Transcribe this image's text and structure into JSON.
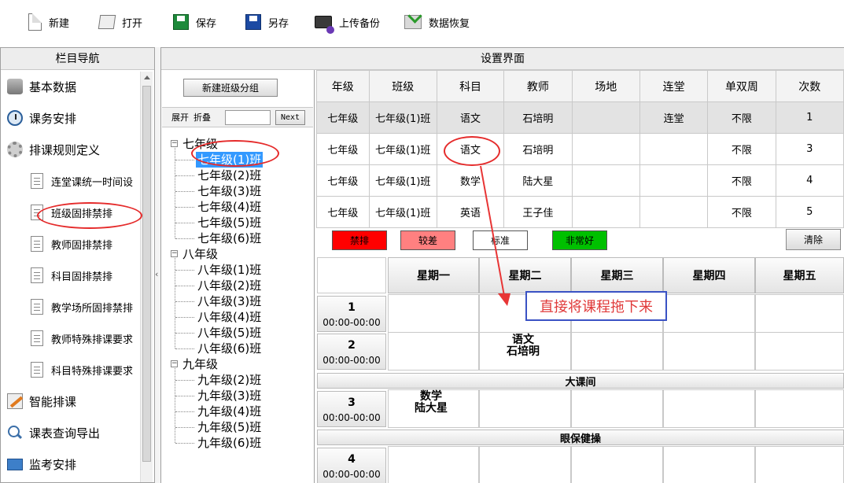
{
  "toolbar": {
    "new_label": "新建",
    "open_label": "打开",
    "save_label": "保存",
    "saveas_label": "另存",
    "upload_label": "上传备份",
    "restore_label": "数据恢复"
  },
  "nav": {
    "title": "栏目导航",
    "items": [
      {
        "label": "基本数据",
        "icon": "database-icon"
      },
      {
        "label": "课务安排",
        "icon": "clock-icon"
      },
      {
        "label": "排课规则定义",
        "icon": "gear-icon"
      },
      {
        "label": "连堂课统一时间设",
        "icon": "document-icon"
      },
      {
        "label": "班级固排禁排",
        "icon": "document-icon"
      },
      {
        "label": "教师固排禁排",
        "icon": "document-icon"
      },
      {
        "label": "科目固排禁排",
        "icon": "document-icon"
      },
      {
        "label": "教学场所固排禁排",
        "icon": "document-icon"
      },
      {
        "label": "教师特殊排课要求",
        "icon": "document-icon"
      },
      {
        "label": "科目特殊排课要求",
        "icon": "document-icon"
      },
      {
        "label": "智能排课",
        "icon": "pencil-icon"
      },
      {
        "label": "课表查询导出",
        "icon": "search-icon"
      },
      {
        "label": "监考安排",
        "icon": "monitor-icon"
      }
    ]
  },
  "main": {
    "title": "设置界面",
    "new_group_label": "新建班级分组",
    "expand_label": "展开",
    "collapse_label": "折叠",
    "search_value": "",
    "next_label": "Next"
  },
  "tree": {
    "grades": [
      {
        "label": "七年级",
        "classes": [
          "七年级(1)班",
          "七年级(2)班",
          "七年级(3)班",
          "七年级(4)班",
          "七年级(5)班",
          "七年级(6)班"
        ]
      },
      {
        "label": "八年级",
        "classes": [
          "八年级(1)班",
          "八年级(2)班",
          "八年级(3)班",
          "八年级(4)班",
          "八年级(5)班",
          "八年级(6)班"
        ]
      },
      {
        "label": "九年级",
        "classes": [
          "九年级(2)班",
          "九年级(3)班",
          "九年级(4)班",
          "九年级(5)班",
          "九年级(6)班"
        ]
      }
    ],
    "selected": "七年级(1)班"
  },
  "course_table": {
    "headers": [
      "年级",
      "班级",
      "科目",
      "教师",
      "场地",
      "连堂",
      "单双周",
      "次数"
    ],
    "rows": [
      [
        "七年级",
        "七年级(1)班",
        "语文",
        "石培明",
        "",
        "连堂",
        "不限",
        "1"
      ],
      [
        "七年级",
        "七年级(1)班",
        "语文",
        "石培明",
        "",
        "",
        "不限",
        "3"
      ],
      [
        "七年级",
        "七年级(1)班",
        "数学",
        "陆大星",
        "",
        "",
        "不限",
        "4"
      ],
      [
        "七年级",
        "七年级(1)班",
        "英语",
        "王子佳",
        "",
        "",
        "不限",
        "5"
      ]
    ]
  },
  "legend": {
    "items": [
      {
        "label": "禁排",
        "color": "#ff0000"
      },
      {
        "label": "较差",
        "color": "#ff8080"
      },
      {
        "label": "标准",
        "color": "#ffffff"
      },
      {
        "label": "非常好",
        "color": "#00c000"
      }
    ],
    "clear_label": "清除"
  },
  "schedule": {
    "days": [
      "星期一",
      "星期二",
      "星期三",
      "星期四",
      "星期五"
    ],
    "periods": [
      {
        "num": "1",
        "time": "00:00-00:00"
      },
      {
        "num": "2",
        "time": "00:00-00:00"
      },
      {
        "num": "3",
        "time": "00:00-00:00"
      },
      {
        "num": "4",
        "time": "00:00-00:00"
      }
    ],
    "breaks": [
      "大课间",
      "眼保健操"
    ],
    "lessons": [
      {
        "subject": "语文",
        "teacher": "石培明"
      },
      {
        "subject": "数学",
        "teacher": "陆大星"
      }
    ]
  },
  "annotation": {
    "callout": "直接将课程拖下来"
  }
}
